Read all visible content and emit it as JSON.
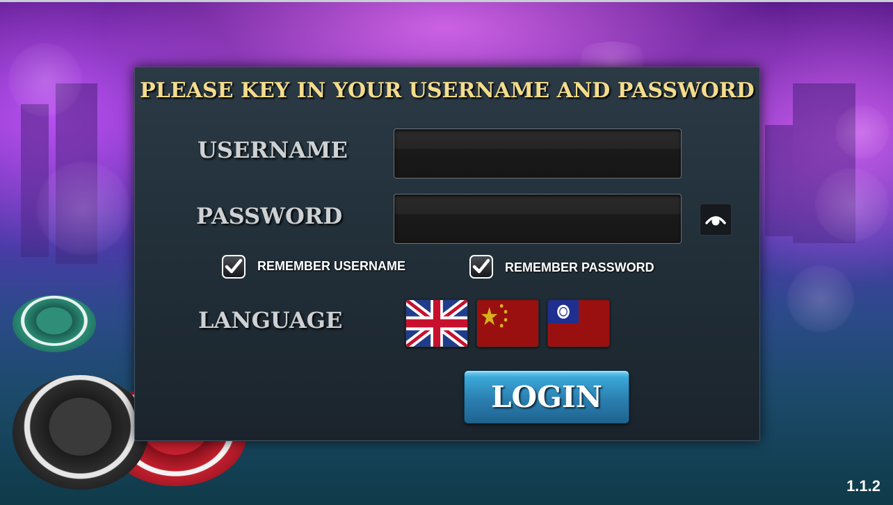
{
  "login_form": {
    "title": "PLEASE KEY IN YOUR USERNAME AND PASSWORD",
    "username_label": "USERNAME",
    "username_value": "",
    "password_label": "PASSWORD",
    "password_value": "",
    "remember_username_label": "REMEMBER USERNAME",
    "remember_username_checked": true,
    "remember_password_label": "REMEMBER PASSWORD",
    "remember_password_checked": true,
    "language_label": "LANGUAGE",
    "languages": [
      "english-flag-icon",
      "china-flag-icon",
      "taiwan-flag-icon"
    ],
    "login_label": "LOGIN"
  },
  "version": "1.1.2",
  "colors": {
    "title": "#f3dc8c",
    "label": "#cdd1d4",
    "login_button": "#2b7fb0",
    "panel": "#22303a"
  }
}
